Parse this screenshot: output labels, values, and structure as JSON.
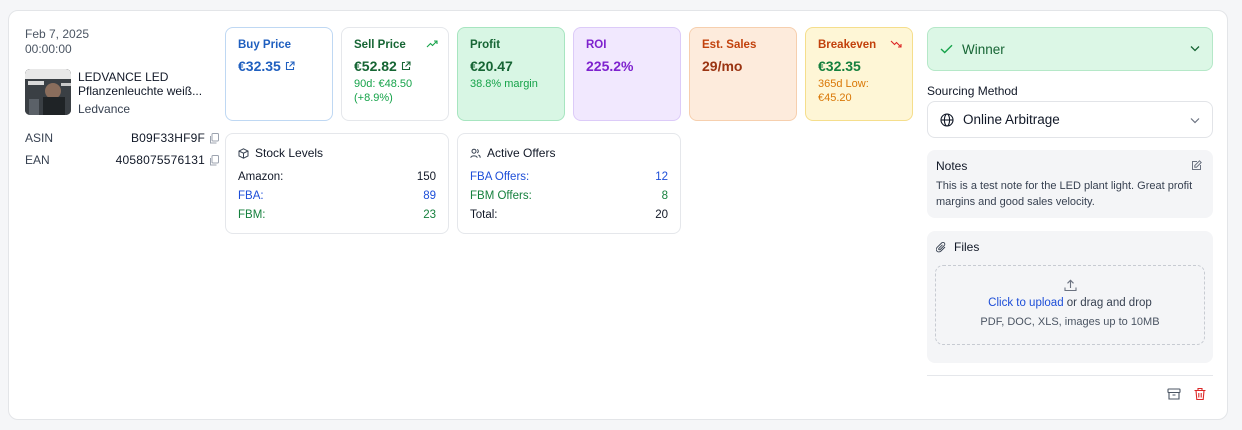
{
  "item": {
    "date": "Feb 7, 2025",
    "time": "00:00:00",
    "title": "LEDVANCE LED Pflanzenleuchte weiß...",
    "title_line1": "LEDVANCE LED",
    "title_line2": "Pflanzenleuchte weiß...",
    "brand": "Ledvance",
    "asin_label": "ASIN",
    "asin": "B09F33HF9F",
    "ean_label": "EAN",
    "ean": "4058075576131"
  },
  "metrics": {
    "buy": {
      "label": "Buy Price",
      "value": "€32.35"
    },
    "sell": {
      "label": "Sell Price",
      "value": "€52.82",
      "sub1": "90d: €48.50",
      "sub2": "(+8.9%)"
    },
    "profit": {
      "label": "Profit",
      "value": "€20.47",
      "sub": "38.8% margin"
    },
    "roi": {
      "label": "ROI",
      "value": "225.2%"
    },
    "sales": {
      "label": "Est. Sales",
      "value": "29/mo"
    },
    "breakeven": {
      "label": "Breakeven",
      "value": "€32.35",
      "sub1": "365d Low:",
      "sub2": "€45.20"
    }
  },
  "stock": {
    "title": "Stock Levels",
    "rows": [
      {
        "label": "Amazon:",
        "value": "150"
      },
      {
        "label": "FBA:",
        "value": "89"
      },
      {
        "label": "FBM:",
        "value": "23"
      }
    ]
  },
  "offers": {
    "title": "Active Offers",
    "rows": [
      {
        "label": "FBA Offers:",
        "value": "12"
      },
      {
        "label": "FBM Offers:",
        "value": "8"
      },
      {
        "label": "Total:",
        "value": "20"
      }
    ]
  },
  "status": {
    "value": "Winner"
  },
  "sourcing": {
    "label": "Sourcing Method",
    "value": "Online Arbitrage"
  },
  "notes": {
    "title": "Notes",
    "text": "This is a test note for the LED plant light. Great profit margins and good sales velocity."
  },
  "files": {
    "title": "Files",
    "upload_link": "Click to upload",
    "upload_rest": " or drag and drop",
    "hint": "PDF, DOC, XLS, images up to 10MB"
  },
  "colors": {
    "winner_bg": "#dcf7e6",
    "winner_text": "#166534",
    "delete": "#dc2626"
  },
  "icons": [
    "external-link-icon",
    "trend-up-icon",
    "trend-down-icon",
    "copy-icon",
    "box-icon",
    "users-icon",
    "check-icon",
    "chevron-down-icon",
    "globe-icon",
    "edit-icon",
    "paperclip-icon",
    "upload-icon",
    "archive-icon",
    "trash-icon"
  ]
}
